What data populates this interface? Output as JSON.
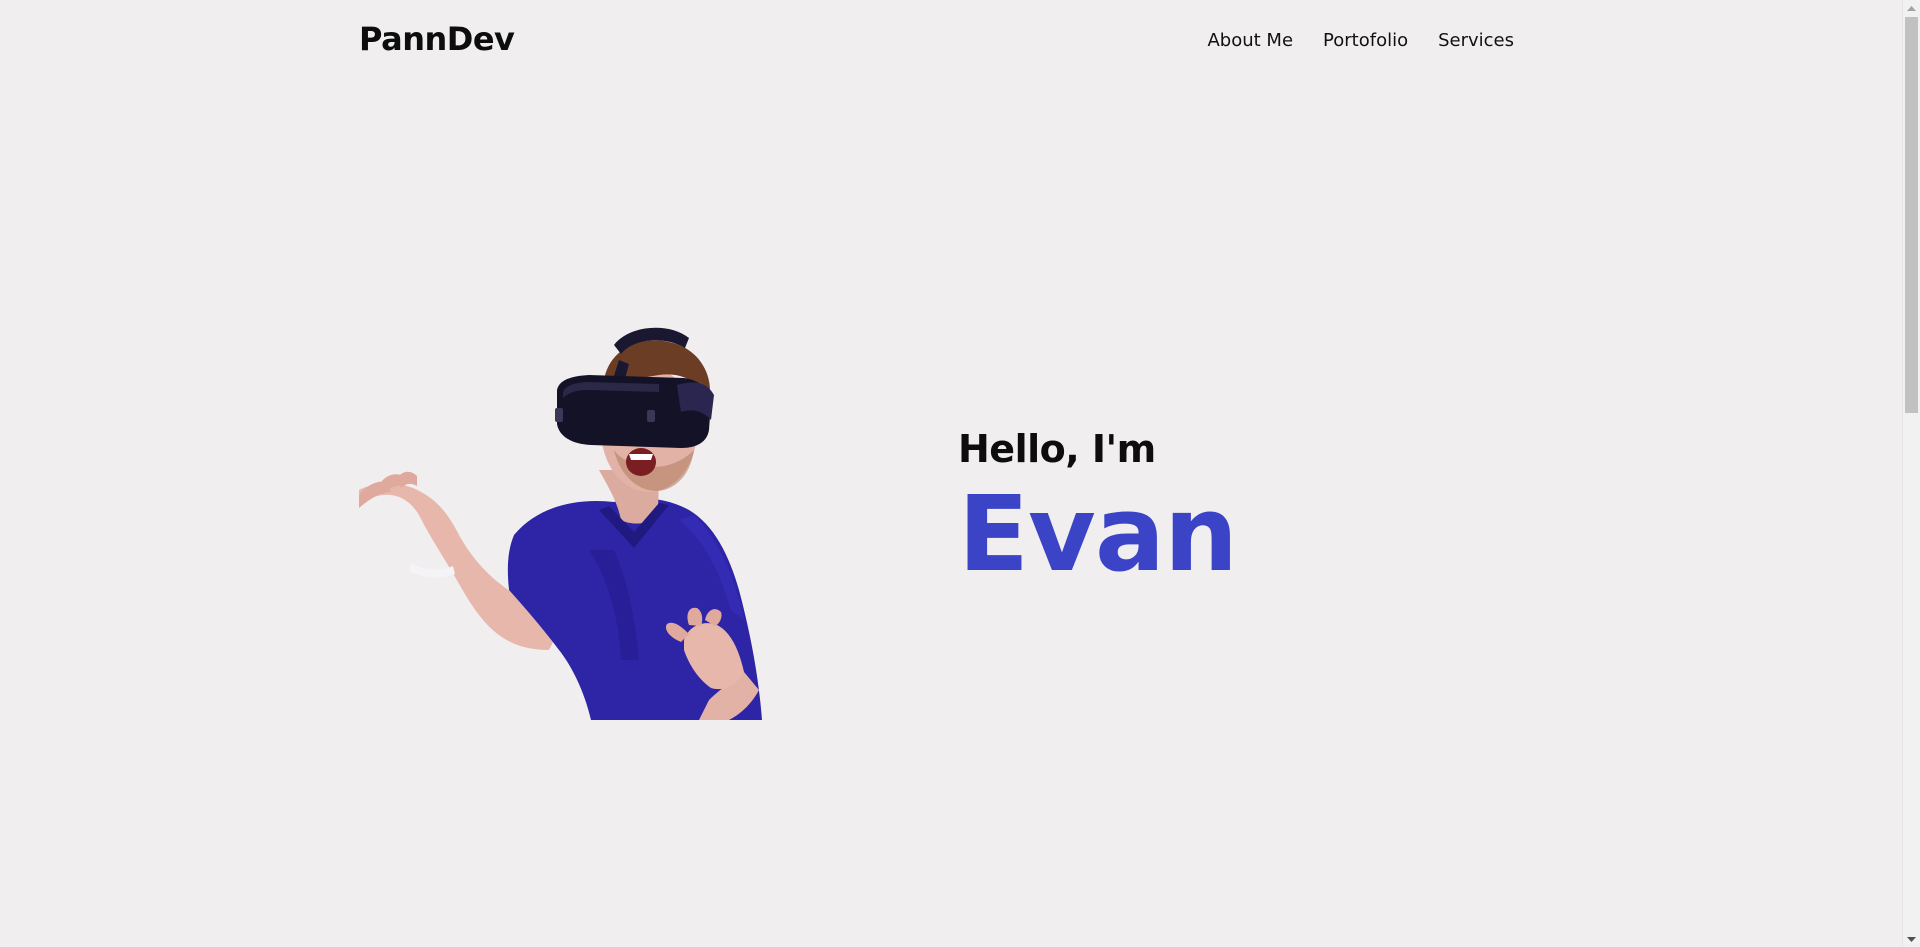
{
  "header": {
    "logo": "PannDev",
    "nav": [
      {
        "label": "About Me"
      },
      {
        "label": "Portofolio"
      },
      {
        "label": "Services"
      }
    ]
  },
  "hero": {
    "greeting": "Hello, I'm",
    "name": "Evan",
    "image_alt": "Man wearing VR headset in blue t-shirt"
  },
  "colors": {
    "background": "#f1eef0",
    "accent": "#3b43c6",
    "text": "#0d0d0d"
  }
}
